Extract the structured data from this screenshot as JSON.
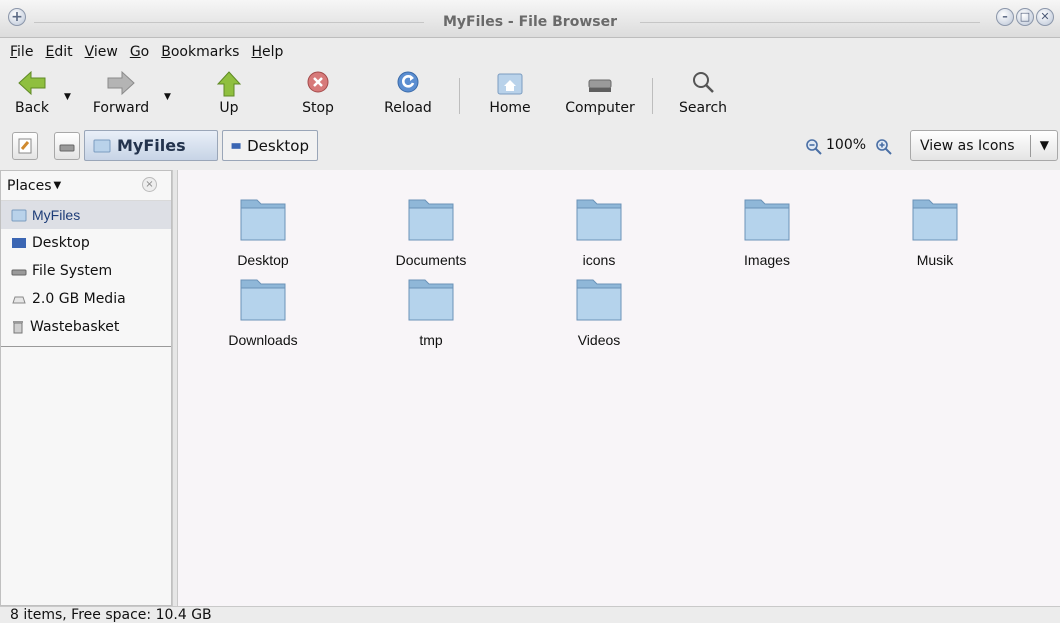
{
  "window": {
    "title": "MyFiles - File Browser"
  },
  "menubar": {
    "items": [
      {
        "label": "File",
        "mnemonic": "F",
        "rest": "ile"
      },
      {
        "label": "Edit",
        "mnemonic": "E",
        "rest": "dit"
      },
      {
        "label": "View",
        "mnemonic": "V",
        "rest": "iew"
      },
      {
        "label": "Go",
        "mnemonic": "G",
        "rest": "o"
      },
      {
        "label": "Bookmarks",
        "mnemonic": "B",
        "rest": "ookmarks"
      },
      {
        "label": "Help",
        "mnemonic": "H",
        "rest": "elp"
      }
    ]
  },
  "toolbar": {
    "back": "Back",
    "forward": "Forward",
    "up": "Up",
    "stop": "Stop",
    "reload": "Reload",
    "home": "Home",
    "computer": "Computer",
    "search": "Search"
  },
  "location": {
    "crumbs": [
      "MyFiles",
      "Desktop"
    ],
    "zoom": "100%",
    "view_mode": "View as Icons"
  },
  "sidebar": {
    "header": "Places",
    "items": [
      {
        "label": "MyFiles",
        "icon": "home-folder-icon",
        "selected": true
      },
      {
        "label": "Desktop",
        "icon": "desktop-icon"
      },
      {
        "label": "File System",
        "icon": "drive-icon"
      },
      {
        "label": "2.0 GB Media",
        "icon": "media-drive-icon"
      },
      {
        "label": "Wastebasket",
        "icon": "trash-icon"
      }
    ]
  },
  "files": [
    {
      "name": "Desktop"
    },
    {
      "name": "Documents"
    },
    {
      "name": "icons"
    },
    {
      "name": "Images"
    },
    {
      "name": "Musik"
    },
    {
      "name": "Downloads"
    },
    {
      "name": "tmp"
    },
    {
      "name": "Videos"
    }
  ],
  "status": {
    "text": "8 items, Free space: 10.4 GB"
  },
  "colors": {
    "folder": "#9ec3df",
    "crumb_active": "#c7d4e6",
    "main_bg": "#f8f5f8"
  }
}
